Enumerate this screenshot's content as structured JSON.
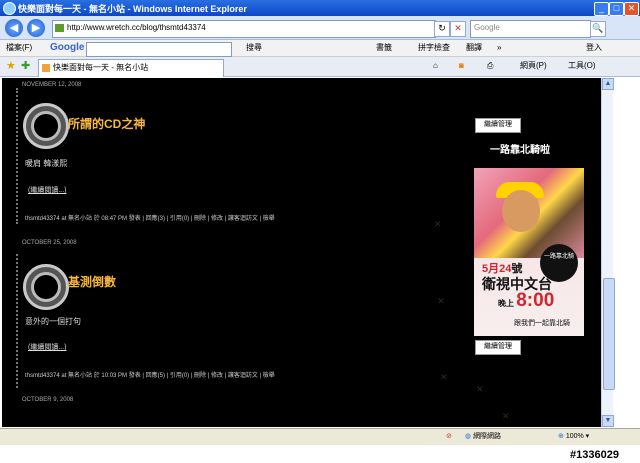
{
  "window": {
    "title": "快樂面對每一天 - 無名小站 - Windows Internet Explorer",
    "min": "_",
    "max": "□",
    "close": "✕"
  },
  "addressbar": {
    "back": "◀",
    "forward": "▶",
    "url": "http://www.wretch.cc/blog/thsmtd43374",
    "refresh": "↻",
    "stop": "✕",
    "search_placeholder": "Google",
    "search_go": "🔍"
  },
  "google_toolbar": {
    "file_menu": "檔案(F)",
    "logo": "Google",
    "search_btn": "搜尋",
    "bookmarks": "書籤",
    "spellcheck": "拼字檢查",
    "translate": "翻譯",
    "more": "»",
    "signin": "登入"
  },
  "tabbar": {
    "tab_title": "快樂面對每一天 - 無名小站",
    "page_menu": "網頁(P)",
    "tools_menu": "工具(O)"
  },
  "posts": [
    {
      "date": "NOVEMBER 12, 2008",
      "title": "所謂的CD之神",
      "body": "暖肩 韓漾熙",
      "more": "(繼續閱讀...)",
      "meta": "thsmtd43374 at 無名小站 於 08:47 PM 發表 | 回應(3) | 引用(0) | 刪除 | 修改 | 讓客迴訪文 | 檢舉"
    },
    {
      "date": "OCTOBER 25, 2008",
      "title": "基測倒數",
      "body": "意外的一個打句",
      "more": "(繼續閱讀...)",
      "meta": "thsmtd43374 at 無名小站 於 10:03 PM 發表 | 回應(5) | 引用(0) | 刪除 | 修改 | 讓客迴訪文 | 檢舉"
    }
  ],
  "next_date": "OCTOBER 9, 2008",
  "sidebar": {
    "manage_label": "繼續管理",
    "title": "一路靠北騎啦",
    "ad": {
      "badge": "一路靠北騎",
      "date_num": "5月24",
      "date_suffix": "號",
      "channel": "衛視中文台",
      "time_prefix": "晚上",
      "time": "8:00",
      "follow": "跟我們一起靠北騎"
    }
  },
  "statusbar": {
    "zone": "網際網路",
    "zoom": "100%"
  },
  "watermark": "#1336029"
}
